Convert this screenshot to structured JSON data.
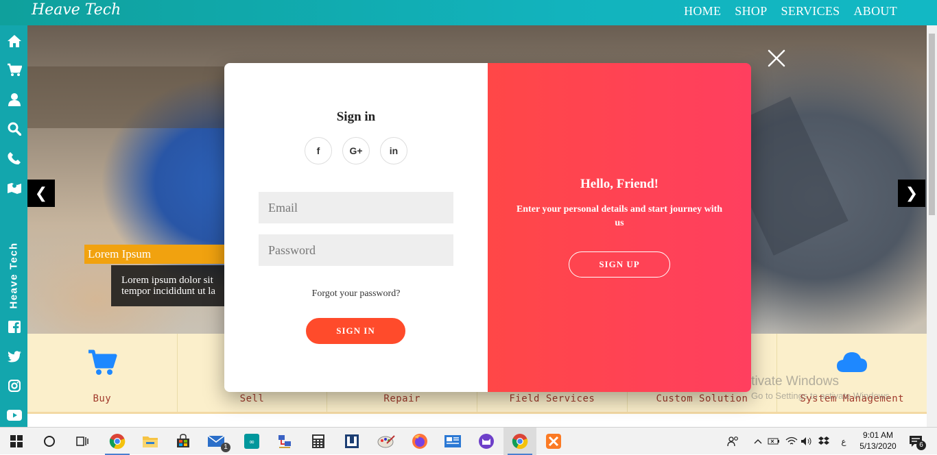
{
  "nav": {
    "brand": "Heave Tech",
    "links": [
      "HOME",
      "SHOP",
      "SERVICES",
      "ABOUT"
    ]
  },
  "sidebar": {
    "brand_vertical": "Heave Tech",
    "icons": [
      "home-icon",
      "cart-icon",
      "user-icon",
      "search-icon",
      "phone-icon",
      "map-icon",
      "facebook-icon",
      "twitter-icon",
      "instagram-icon",
      "youtube-icon"
    ]
  },
  "hero": {
    "caption_title": "Lorem Ipsum",
    "caption_line1": "Lorem ipsum dolor sit",
    "caption_line2": "tempor incididunt ut la",
    "prev_glyph": "❮",
    "next_glyph": "❯"
  },
  "services": {
    "items": [
      "Buy",
      "Sell",
      "Repair",
      "Field Services",
      "Custom Solution",
      "System Management"
    ]
  },
  "modal": {
    "signin_title": "Sign in",
    "social": [
      "f",
      "G+",
      "in"
    ],
    "email_placeholder": "Email",
    "password_placeholder": "Password",
    "forgot": "Forgot your password?",
    "signin_button": "SIGN IN",
    "hello_title": "Hello, Friend!",
    "hello_text": "Enter your personal details and start journey with us",
    "signup_button": "SIGN UP"
  },
  "watermark": {
    "line1": "Activate Windows",
    "line2": "Go to Settings to activate Windows."
  },
  "taskbar": {
    "time": "9:01 AM",
    "date": "5/13/2020",
    "mail_badge": "1",
    "notification_count": "6",
    "lang": "ع"
  },
  "colors": {
    "nav_teal": "#12b3bd",
    "sidebar_teal": "#13a6ad",
    "signin_orange": "#ff4b2b",
    "panel_red": "#ff4152",
    "service_bg": "#fbefcb",
    "service_text": "#a13a2c",
    "icon_blue": "#1e88ff"
  }
}
